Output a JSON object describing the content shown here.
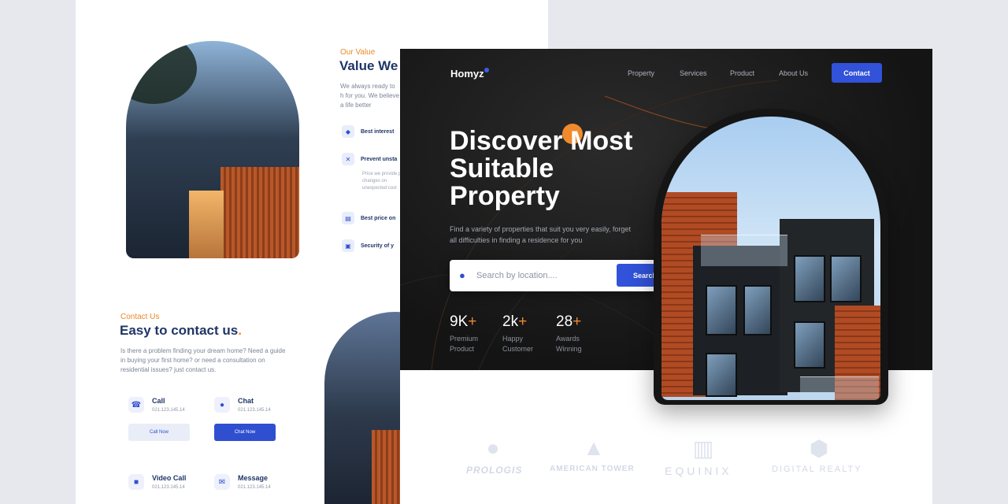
{
  "nav": {
    "logo": "Homyz",
    "items": [
      "Property",
      "Services",
      "Product",
      "About Us"
    ],
    "contact_label": "Contact"
  },
  "hero": {
    "headline": "Discover Most Suitable Property",
    "subtitle": "Find a variety of properties that suit you very easily, forget all  difficulties in finding a residence for you",
    "search_placeholder": "Search by location....",
    "search_label": "Search",
    "stats": [
      {
        "value": "9K",
        "plus": "+",
        "label": "Premium Product"
      },
      {
        "value": "2k",
        "plus": "+",
        "label": "Happy Customer"
      },
      {
        "value": "28",
        "plus": "+",
        "label": "Awards Winning"
      }
    ]
  },
  "partners": [
    "PROLOGIS",
    "AMERICAN TOWER",
    "EQUINIX",
    "DIGITAL REALTY"
  ],
  "value_section": {
    "kicker": "Our Value",
    "title": "Value We",
    "text": "We always ready to h for you. We believe a life better",
    "items": [
      {
        "label": "Best interest"
      },
      {
        "label": "Prevent unsta"
      },
      {
        "label": "Best price on"
      },
      {
        "label": "Security of y"
      }
    ],
    "item_sub": "Price we provide price changes on unexpected cost"
  },
  "contact_section": {
    "kicker": "Contact Us",
    "title": "Easy to contact us",
    "text": "Is there a problem finding your dream home? Need a guide in buying your first home? or need a consultation on residential issues? just contact us.",
    "cards": [
      {
        "title": "Call",
        "number": "021.123.145.14",
        "button": "Call Now"
      },
      {
        "title": "Chat",
        "number": "021.123.145.14",
        "button": "Chat Now"
      },
      {
        "title": "Video Call",
        "number": "021.123.145.14"
      },
      {
        "title": "Message",
        "number": "021.123.145.14"
      }
    ]
  },
  "colors": {
    "accent": "#3152d9",
    "orange": "#f08a2c",
    "dark": "#141414"
  }
}
